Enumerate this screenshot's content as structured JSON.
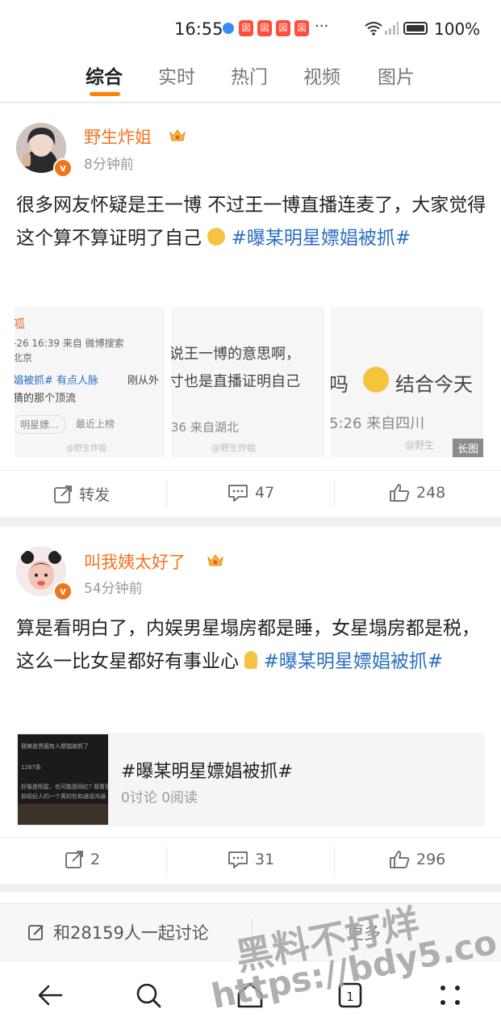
{
  "status_bar": {
    "time": "16:55",
    "notif_glyph": "図",
    "more": "···",
    "battery": "100%"
  },
  "tabs": [
    {
      "label": "综合",
      "active": true
    },
    {
      "label": "实时"
    },
    {
      "label": "热门"
    },
    {
      "label": "视频"
    },
    {
      "label": "图片"
    }
  ],
  "posts": [
    {
      "author": "野生炸姐",
      "time": "8分钟前",
      "text_plain": "很多网友怀疑是王一博 不过王一博直播连麦了，大家觉得这个算不算证明了自己",
      "hashtag": "#曝某明星嫖娼被抓#",
      "images": {
        "img1": {
          "line1": "呱",
          "line2": "-26 16:39  来自 微博搜索",
          "line3": "北京",
          "line4": "娼被抓# 有点人脉",
          "line4b": "刚从外",
          "line5": "猜的那个顶流",
          "line6": "明星嫖...",
          "line6b": "最近上榜",
          "wm": "@野生炸姐"
        },
        "img2": {
          "line1": "说王一博的意思啊，",
          "line2": "寸也是直播证明自己",
          "line3": "36  来自湖北",
          "wm": "@野生炸姐"
        },
        "img3": {
          "line1": "吗",
          "line2": "结合今天",
          "line3": "5:26  来自四川",
          "wm": "@野生",
          "long_tag": "长图"
        }
      },
      "actions": {
        "repost": "转发",
        "comments": "47",
        "likes": "248"
      }
    },
    {
      "author": "叫我姨太好了",
      "time": "54分钟前",
      "text_plain": "算是看明白了，内娱男星塌房都是睡，女星塌房都是税，这么一比女星都好有事业心",
      "hashtag": "#曝某明星嫖娼被抓#",
      "topic": {
        "title": "#曝某明星嫖娼被抓#",
        "stats": "0讨论 0阅读",
        "thumb_lines": [
          "我嘛是贵圈有人嫖娼被抓了",
          "1287条",
          "好像是明星，也可能是网红? 我看到以",
          "前经纪人的一个男的在和通话沟通"
        ]
      },
      "actions": {
        "repost": "2",
        "comments": "31",
        "likes": "296"
      }
    }
  ],
  "bottom_bar": {
    "discuss": "和28159人一起讨论",
    "more": "更多"
  },
  "watermark": {
    "line1": "黑料不打烊",
    "line2": "https://bdy5.co"
  },
  "colors": {
    "accent": "#ff8200",
    "username": "#f47321",
    "hashtag": "#2b6fc2"
  }
}
